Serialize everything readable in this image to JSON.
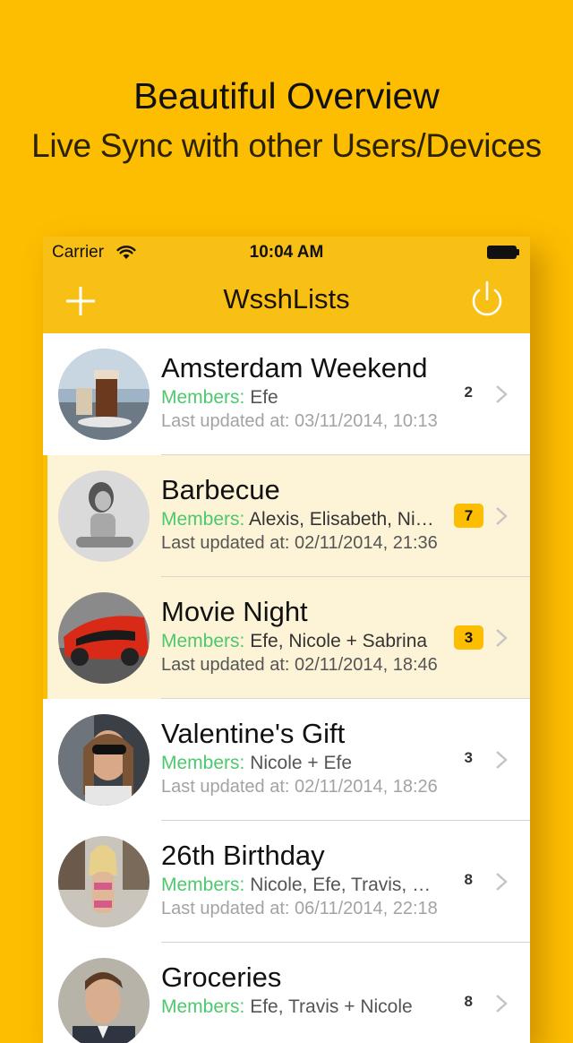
{
  "promo": {
    "headline": "Beautiful Overview",
    "subline": "Live Sync with other Users/Devices"
  },
  "status_bar": {
    "carrier": "Carrier",
    "time": "10:04 AM"
  },
  "nav": {
    "title": "WsshLists",
    "add_icon": "plus-icon",
    "power_icon": "power-icon"
  },
  "members_label": "Members:",
  "lists": [
    {
      "title": "Amsterdam Weekend",
      "members": "Efe",
      "updated": "Last updated at: 03/11/2014, 10:13",
      "count": "2",
      "unread": false
    },
    {
      "title": "Barbecue",
      "members": "Alexis, Elisabeth, Nicole + Efe",
      "updated": "Last updated at: 02/11/2014, 21:36",
      "count": "7",
      "unread": true
    },
    {
      "title": "Movie Night",
      "members": "Efe, Nicole + Sabrina",
      "updated": "Last updated at: 02/11/2014, 18:46",
      "count": "3",
      "unread": true
    },
    {
      "title": "Valentine's Gift",
      "members": "Nicole + Efe",
      "updated": "Last updated at: 02/11/2014, 18:26",
      "count": "3",
      "unread": false
    },
    {
      "title": "26th Birthday",
      "members": "Nicole, Efe, Travis, Sabrina + Alexis",
      "updated": "Last updated at: 06/11/2014, 22:18",
      "count": "8",
      "unread": false
    },
    {
      "title": "Groceries",
      "members": "Efe, Travis + Nicole",
      "updated": "",
      "count": "8",
      "unread": false
    }
  ],
  "colors": {
    "background": "#FDBD00",
    "bar": "#F8BF14",
    "members_label": "#4CC96D",
    "unread_row": "#FDF3D6"
  }
}
